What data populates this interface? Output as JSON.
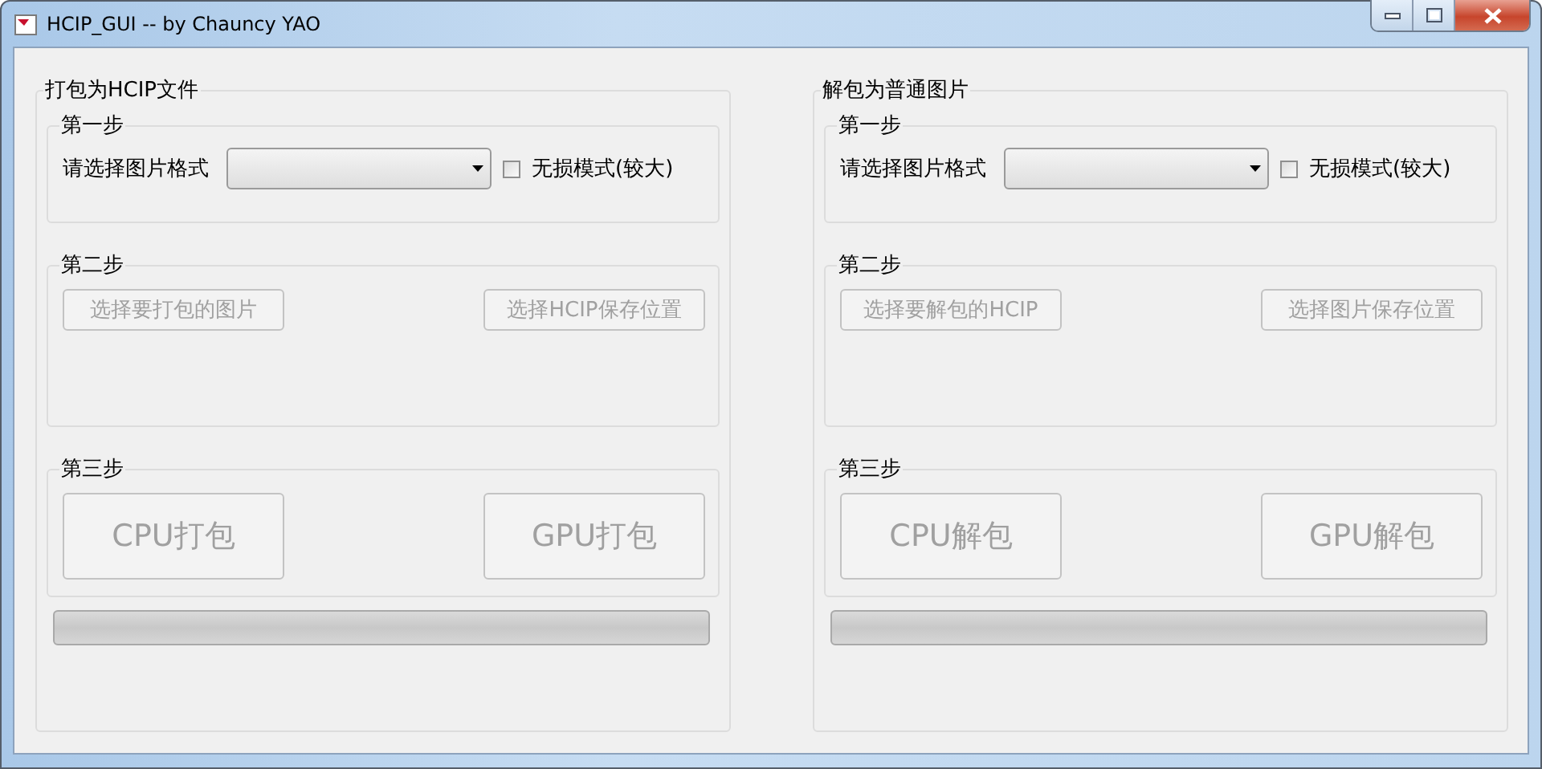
{
  "window": {
    "title": "HCIP_GUI -- by Chauncy YAO"
  },
  "panels": [
    {
      "title": "打包为HCIP文件",
      "step1": {
        "title": "第一步",
        "label": "请选择图片格式",
        "lossless": {
          "label": "无损模式(较大)",
          "checked": false
        }
      },
      "step2": {
        "title": "第二步",
        "buttons": [
          {
            "label": "选择要打包的图片",
            "disabled": true
          },
          {
            "label": "选择HCIP保存位置",
            "disabled": true
          }
        ]
      },
      "step3": {
        "title": "第三步",
        "buttons": [
          {
            "label": "CPU打包",
            "disabled": true
          },
          {
            "label": "GPU打包",
            "disabled": true
          }
        ]
      },
      "progress": {
        "level": 0
      }
    },
    {
      "title": "解包为普通图片",
      "step1": {
        "title": "第一步",
        "label": "请选择图片格式",
        "lossless": {
          "label": "无损模式(较大)",
          "checked": false
        }
      },
      "step2": {
        "title": "第二步",
        "buttons": [
          {
            "label": "选择要解包的HCIP",
            "disabled": true
          },
          {
            "label": "选择图片保存位置",
            "disabled": true
          }
        ]
      },
      "step3": {
        "title": "第三步",
        "buttons": [
          {
            "label": "CPU解包",
            "disabled": true
          },
          {
            "label": "GPU解包",
            "disabled": true
          }
        ]
      },
      "progress": {
        "level": 0
      }
    }
  ]
}
